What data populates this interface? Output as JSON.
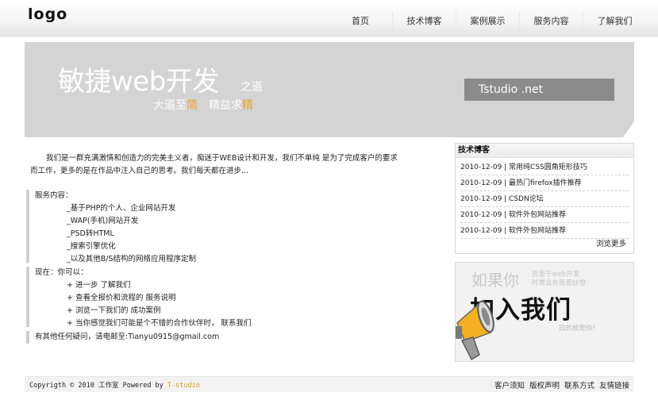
{
  "header": {
    "logo": "logo",
    "nav": [
      "首页",
      "技术博客",
      "案例展示",
      "服务内容",
      "了解我们"
    ]
  },
  "banner": {
    "title": "敏捷web开发",
    "title_suffix": "之道",
    "slogan_1": "大道至",
    "slogan_1_hl": "简",
    "slogan_2": "精益求",
    "slogan_2_hl": "精",
    "brand_box": "Tstudio .net"
  },
  "intro": "我们是一群充满激情和创造力的完美主义者，痴迷于WEB设计和开发，我们不单纯 是为了完成客户的要求而工作，更多的是在作品中注入自己的思考。我们每天都在进步...",
  "services": {
    "title": "服务内容：",
    "items": [
      "_基于PHP的个人、企业网站开发",
      "_WAP(手机)网站开发",
      "_PSD转HTML",
      "_搜索引擎优化",
      "_以及其他B/S结构的网络应用程序定制"
    ]
  },
  "now": {
    "title": "现在：你可以：",
    "items": [
      "进一步 了解我们",
      "查看全报价和流程的 服务说明",
      "浏览一下我们的 成功案例",
      "当你感觉我们可能是个不错的合作伙伴时， 联系我们"
    ]
  },
  "contact": "有其他任何疑问，请电邮至:Tianyu0915@gmail.com",
  "tech_blog": {
    "title": "技术博客",
    "items": [
      "2010-12-09 | 常用纯CSS圆角矩形技巧",
      "2010-12-09 | 最热门firefox插件推荐",
      "2010-12-09 | CSDN论坛",
      "2010-12-09 | 软件外包网站推荐",
      "2010-12-09 | 软件外包网站推荐"
    ],
    "more": "浏览更多"
  },
  "join": {
    "ghost": "如果你",
    "small_1": "热衷于web开发",
    "small_2": "时常会有奇思妙想",
    "main": "加入我们",
    "found": "找的就是你!"
  },
  "footer": {
    "copyright": "Copyrigth © 2010 工作室 Powered by ",
    "brand": "T-studio",
    "links": [
      "客户须知",
      "版权声明",
      "联系方式",
      "友情链接"
    ]
  },
  "colors": {
    "accent_orange": "#f0a020",
    "banner_bg": "#d4d4d4",
    "brand_box_bg": "#8b8b8b"
  }
}
